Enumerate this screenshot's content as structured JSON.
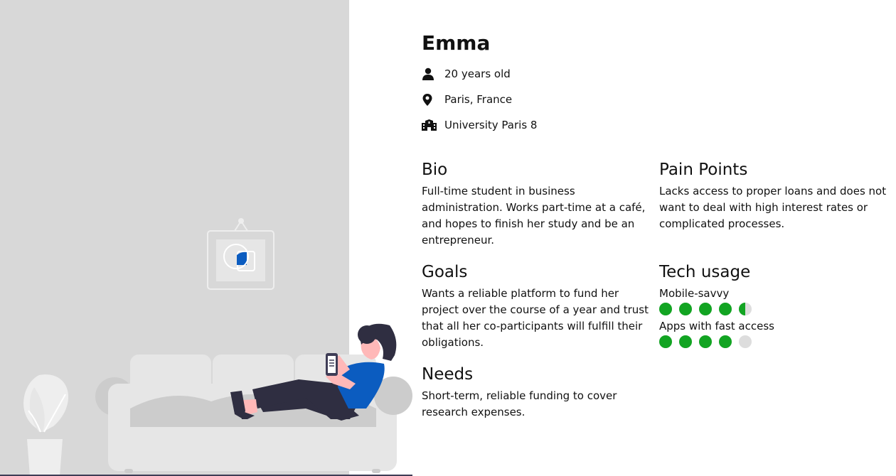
{
  "persona": {
    "name": "Emma",
    "age": "20 years old",
    "location": "Paris, France",
    "school": "University Paris 8"
  },
  "sections": {
    "bio": {
      "title": "Bio",
      "text": "Full-time student in business administration. Works part-time at a café, and hopes to finish her study and be an entrepreneur."
    },
    "pain_points": {
      "title": "Pain Points",
      "text": "Lacks access to proper loans and does not want to deal with high interest rates or complicated processes."
    },
    "goals": {
      "title": "Goals",
      "text": "Wants a reliable platform to fund her project over the course of a year and trust that all her co-participants will fulfill their obligations."
    },
    "needs": {
      "title": "Needs",
      "text": "Short-term, reliable funding to cover research expenses."
    },
    "tech": {
      "title": "Tech usage",
      "ratings": [
        {
          "label": "Mobile-savvy",
          "value": 4.5,
          "max": 5
        },
        {
          "label": "Apps with fast access",
          "value": 4,
          "max": 5
        }
      ]
    }
  },
  "icons": [
    "person-icon",
    "location-pin-icon",
    "school-building-icon"
  ],
  "colors": {
    "illustration_bg": "#d8d8d8",
    "rating_filled": "#12a422",
    "rating_empty": "#dddddd",
    "accent_blue": "#0b5cc0",
    "dark_navy": "#2f2e41",
    "skin": "#ffb8b8"
  }
}
